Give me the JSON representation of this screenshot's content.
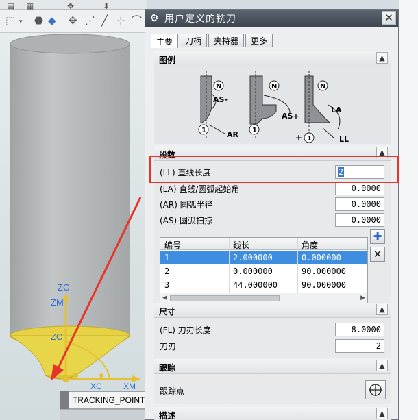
{
  "dialog": {
    "title": "用户定义的铣刀",
    "close_label": "✕"
  },
  "tabs": [
    {
      "label": "主要",
      "active": true
    },
    {
      "label": "刀柄",
      "active": false
    },
    {
      "label": "夹持器",
      "active": false
    },
    {
      "label": "更多",
      "active": false
    }
  ],
  "legend_section": {
    "title": "图例",
    "labels": {
      "n": "N",
      "one": "1",
      "as_minus": "AS-",
      "ar": "AR",
      "as_plus": "AS+",
      "la": "LA",
      "ll": "LL",
      "plus": "+"
    }
  },
  "segments_section": {
    "title": "段数",
    "fields": [
      {
        "label": "(LL) 直线长度",
        "value": "2",
        "selected": true
      },
      {
        "label": "(LA) 直线/圆弧起始角",
        "value": "0.0000"
      },
      {
        "label": "(AR) 圆弧半径",
        "value": "0.0000"
      },
      {
        "label": "(AS) 圆弧扫掠",
        "value": "0.0000"
      }
    ],
    "table": {
      "headers": [
        "编号",
        "线长",
        "角度"
      ],
      "rows": [
        {
          "num": "1",
          "length": "2.000000",
          "angle": "0.000000",
          "selected": true
        },
        {
          "num": "2",
          "length": "0.000000",
          "angle": "90.000000"
        },
        {
          "num": "3",
          "length": "44.000000",
          "angle": "90.000000"
        }
      ]
    },
    "add_icon": "add-segment-icon",
    "delete_icon": "delete-segment-icon"
  },
  "dimensions_section": {
    "title": "尺寸",
    "fields": [
      {
        "label": "(FL) 刀刃长度",
        "value": "8.0000"
      },
      {
        "label": "刀刃",
        "value": "2"
      }
    ]
  },
  "tracking_section": {
    "title": "跟踪",
    "label": "跟踪点",
    "icon": "crosshair-icon"
  },
  "description_section": {
    "title": "描述"
  },
  "viewport": {
    "axis_labels": {
      "zc_top": "ZC",
      "zm": "ZM",
      "zc_mid": "ZC",
      "xc": "XC",
      "xm": "XM"
    },
    "tracking_label": "TRACKING_POINT_",
    "accent_color": "#e8332a",
    "tool_color": "#b9bcbd",
    "tip_color": "#e8d64a"
  }
}
